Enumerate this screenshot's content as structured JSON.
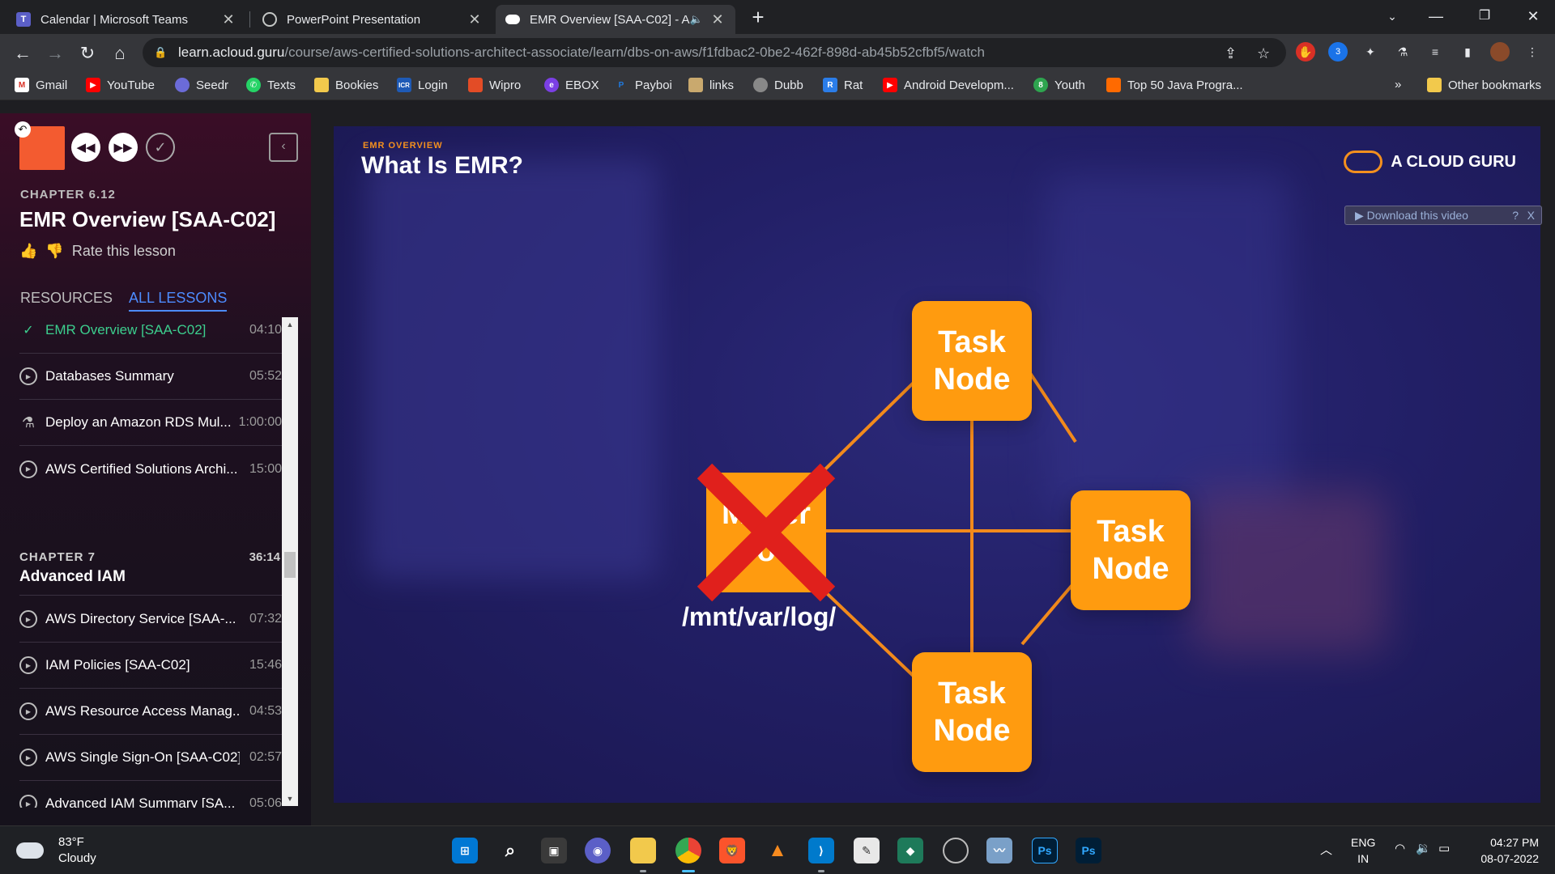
{
  "browser": {
    "tabs": [
      {
        "title": "Calendar | Microsoft Teams",
        "icon": "teams-icon"
      },
      {
        "title": "PowerPoint Presentation",
        "icon": "globe-icon"
      },
      {
        "title": "EMR Overview [SAA-C02] - A",
        "icon": "acloudguru-icon"
      }
    ],
    "address": {
      "host": "learn.acloud.guru",
      "path": "/course/aws-certified-solutions-architect-associate/learn/dbs-on-aws/f1fdbac2-0be2-462f-898d-ab45b52cfbf5/watch"
    },
    "ext_badge": "3",
    "bookmarks": [
      "Gmail",
      "YouTube",
      "Seedr",
      "Texts",
      "Bookies",
      "Login",
      "Wipro",
      "EBOX",
      "Payboi",
      "links",
      "Dubb",
      "Rat",
      "Android Developm...",
      "Youth",
      "Top 50 Java Progra..."
    ],
    "bookmarks_more": "»",
    "other_bookmarks": "Other bookmarks",
    "bm_icon_texts": {
      "login": "ICR",
      "rat": "R"
    }
  },
  "sidebar": {
    "chapter_label": "CHAPTER 6.12",
    "lesson_title": "EMR Overview [SAA-C02]",
    "rate_label": "Rate this lesson",
    "tabs": [
      "RESOURCES",
      "ALL LESSONS"
    ],
    "lessons_top": [
      {
        "name": "EMR Overview [SAA-C02]",
        "duration": "04:10",
        "state": "current"
      },
      {
        "name": "Databases Summary",
        "duration": "05:52",
        "state": "video"
      },
      {
        "name": "Deploy an Amazon RDS Mul...",
        "duration": "1:00:00",
        "state": "lab"
      },
      {
        "name": "AWS Certified Solutions Archi...",
        "duration": "15:00",
        "state": "video"
      }
    ],
    "chapter7": {
      "label": "CHAPTER 7",
      "duration": "36:14",
      "title": "Advanced IAM"
    },
    "lessons_bottom": [
      {
        "name": "AWS Directory Service [SAA-...",
        "duration": "07:32"
      },
      {
        "name": "IAM Policies [SAA-C02]",
        "duration": "15:46"
      },
      {
        "name": "AWS Resource Access Manag...",
        "duration": "04:53"
      },
      {
        "name": "AWS Single Sign-On [SAA-C02]",
        "duration": "02:57"
      },
      {
        "name": "Advanced IAM Summary [SA...",
        "duration": "05:06"
      }
    ]
  },
  "video": {
    "eyebrow": "EMR OVERVIEW",
    "title": "What Is EMR?",
    "logo": "A CLOUD GURU",
    "task_node_lines": [
      "Task",
      "Node"
    ],
    "master_partial": "M    er\n  o  ",
    "path_label": "/mnt/var/log/",
    "download_label": "▶ Download this video",
    "download_help": "?",
    "download_close": "X"
  },
  "taskbar": {
    "temp": "83°F",
    "condition": "Cloudy",
    "lang": "ENG",
    "region": "IN",
    "time": "04:27 PM",
    "date": "08-07-2022",
    "app_texts": {
      "ps1": "Ps",
      "ps2": "Ps"
    }
  },
  "colors": {
    "accent": "#ff9b0f",
    "lesson_active": "#3ccf8e",
    "tab_active": "#4d8cff"
  }
}
